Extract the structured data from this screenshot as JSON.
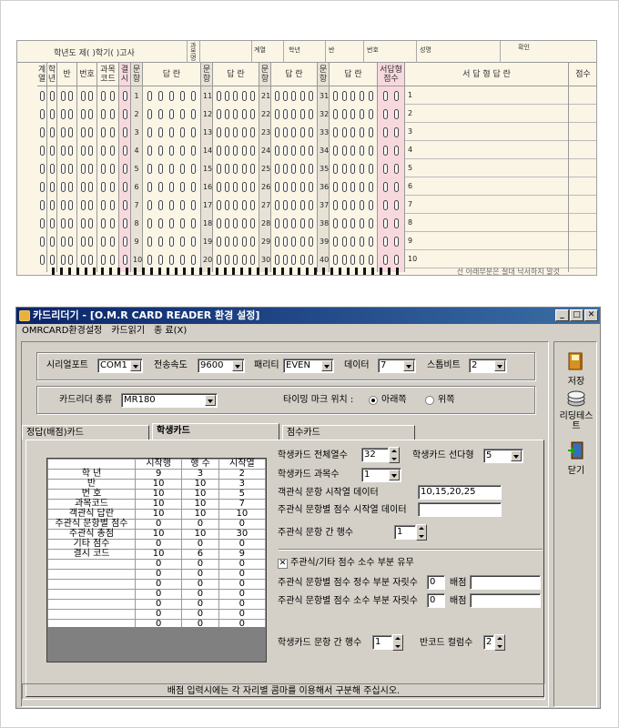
{
  "card": {
    "header_left": "학년도 제(     )학기(      )고사",
    "header_labels": [
      "과목명",
      "계열",
      "학년",
      "반",
      "번호",
      "성명",
      "확인"
    ],
    "columns": [
      "계열",
      "학년",
      "반",
      "번호",
      "과목코드",
      "결시",
      "문항",
      "답 란",
      "문항",
      "답 란",
      "문항",
      "답 란",
      "문항",
      "답 란",
      "서답형점수",
      "서 답 형 답 란",
      "점수"
    ],
    "footer": "선 아래부분은 절대 낙서하지 말것",
    "q_start": [
      1,
      11,
      21,
      31
    ],
    "essay_nums": [
      "1",
      "2",
      "3",
      "4",
      "5",
      "6",
      "7",
      "8",
      "9",
      "10"
    ]
  },
  "window": {
    "title": "카드리더기 - [O.M.R CARD READER 환경 설정]",
    "menu": [
      "OMRCARD환경설정",
      "카드읽기",
      "종 료(X)"
    ],
    "serial": {
      "port_label": "시리얼포트",
      "port": "COM1",
      "speed_label": "전송속도",
      "speed": "9600",
      "parity_label": "패리티",
      "parity": "EVEN",
      "data_label": "데이터",
      "data": "7",
      "stop_label": "스톱비트",
      "stop": "2"
    },
    "reader": {
      "type_label": "카드리더 종류",
      "type": "MR180",
      "timing_label": "타이밍 마크 위치 :",
      "opt_bottom": "아래쪽",
      "opt_top": "위쪽"
    },
    "tabs": [
      "정답(배점)카드",
      "학생카드",
      "점수카드"
    ],
    "grid": {
      "headers": [
        "시작행",
        "행 수",
        "시작열"
      ],
      "rows": [
        {
          "label": "학 년",
          "v": [
            "9",
            "3",
            "2"
          ]
        },
        {
          "label": "반",
          "v": [
            "10",
            "10",
            "3"
          ]
        },
        {
          "label": "번 호",
          "v": [
            "10",
            "10",
            "5"
          ]
        },
        {
          "label": "과목코드",
          "v": [
            "10",
            "10",
            "7"
          ]
        },
        {
          "label": "객관식 답란",
          "v": [
            "10",
            "10",
            "10"
          ]
        },
        {
          "label": "주관식 문항별 점수",
          "v": [
            "0",
            "0",
            "0"
          ]
        },
        {
          "label": "주관식 총점",
          "v": [
            "10",
            "10",
            "30"
          ]
        },
        {
          "label": "기타 점수",
          "v": [
            "0",
            "0",
            "0"
          ]
        },
        {
          "label": "결시 코드",
          "v": [
            "10",
            "6",
            "9"
          ]
        },
        {
          "label": "",
          "v": [
            "0",
            "0",
            "0"
          ]
        },
        {
          "label": "",
          "v": [
            "0",
            "0",
            "0"
          ]
        },
        {
          "label": "",
          "v": [
            "0",
            "0",
            "0"
          ]
        },
        {
          "label": "",
          "v": [
            "0",
            "0",
            "0"
          ]
        },
        {
          "label": "",
          "v": [
            "0",
            "0",
            "0"
          ]
        },
        {
          "label": "",
          "v": [
            "0",
            "0",
            "0"
          ]
        },
        {
          "label": "",
          "v": [
            "0",
            "0",
            "0"
          ]
        }
      ]
    },
    "student": {
      "total_cols_label": "학생카드 전체열수",
      "total_cols": "32",
      "options_label": "학생카드 선다형",
      "options": "5",
      "subjects_label": "학생카드 과목수",
      "subjects": "1",
      "obj_start_label": "객관식 문항 시작열 데이터",
      "obj_start": "10,15,20,25",
      "subj_start_label": "주관식 문항별 점수 시작열 데이터",
      "subj_start": "",
      "subj_rows_label": "주관식 문항 간 행수",
      "subj_rows": "1",
      "decimal_label": "주관식/기타 점수 소수 부분 유무",
      "int_digits_label": "주관식 문항별 점수 정수 부분 자릿수",
      "int_digits": "0",
      "dec_digits_label": "주관식 문항별 점수 소수 부분 자릿수",
      "dec_digits": "0",
      "weight_label": "배점",
      "q_rows_label": "학생카드 문항 간 행수",
      "q_rows": "1",
      "barcode_label": "반코드 컬럼수",
      "barcode": "2"
    },
    "status": "배점 입력시에는 각 자리별 콤마를 이용해서 구분해 주십시오.",
    "side": [
      "저장",
      "리딩테스트",
      "닫기"
    ]
  }
}
